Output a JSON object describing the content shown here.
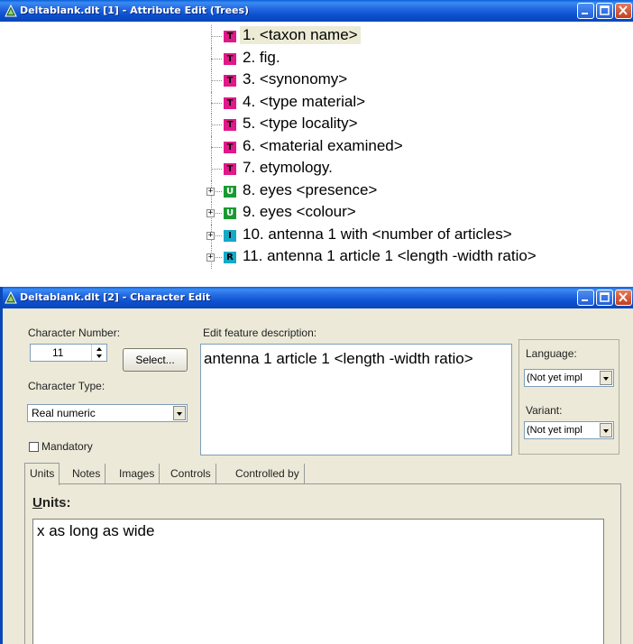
{
  "window1": {
    "title": "Deltablank.dlt [1] - Attribute Edit (Trees)",
    "tree": [
      {
        "badge": "T",
        "label": "1. <taxon name>",
        "expandable": false,
        "selected": true
      },
      {
        "badge": "T",
        "label": "2. fig.",
        "expandable": false
      },
      {
        "badge": "T",
        "label": "3. <synonomy>",
        "expandable": false
      },
      {
        "badge": "T",
        "label": "4. <type material>",
        "expandable": false
      },
      {
        "badge": "T",
        "label": "5. <type locality>",
        "expandable": false
      },
      {
        "badge": "T",
        "label": "6. <material examined>",
        "expandable": false
      },
      {
        "badge": "T",
        "label": "7. etymology.",
        "expandable": false
      },
      {
        "badge": "U",
        "label": "8. eyes <presence>",
        "expandable": true
      },
      {
        "badge": "U",
        "label": "9. eyes <colour>",
        "expandable": true
      },
      {
        "badge": "I",
        "label": "10. antenna 1 with <number of articles>",
        "expandable": true
      },
      {
        "badge": "R",
        "label": "11. antenna 1 article 1 <length -width ratio>",
        "expandable": true
      }
    ]
  },
  "window2": {
    "title": "Deltablank.dlt [2] - Character Edit",
    "character_number_label": "Character Number:",
    "character_number_value": "11",
    "select_button": "Select...",
    "character_type_label": "Character Type:",
    "character_type_value": "Real numeric",
    "mandatory_label": "Mandatory",
    "feature_label": "Edit feature description:",
    "feature_text": "antenna 1 article 1 <length -width ratio>",
    "language_label": "Language:",
    "language_value": "(Not yet impl",
    "variant_label": "Variant:",
    "variant_value": "(Not yet impl",
    "tabs": [
      "Units",
      "Notes",
      "Images",
      "Controls",
      "Controlled by"
    ],
    "units_label": "Units:",
    "units_value": "x as long as wide"
  }
}
